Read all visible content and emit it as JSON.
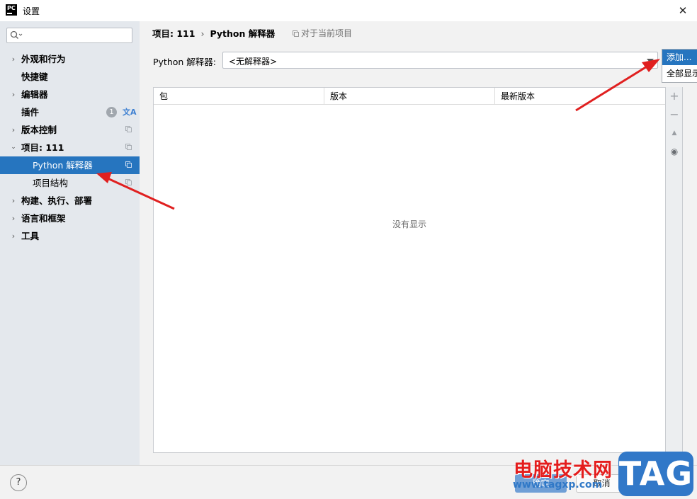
{
  "window": {
    "title": "设置",
    "logo_text": "PC",
    "close_glyph": "✕"
  },
  "sidebar": {
    "search": {
      "placeholder": ""
    },
    "items": [
      {
        "label": "外观和行为",
        "expandable": true
      },
      {
        "label": "快捷键",
        "expandable": false
      },
      {
        "label": "编辑器",
        "expandable": true
      },
      {
        "label": "插件",
        "expandable": false,
        "badge": "1",
        "translate_icon": "文A"
      },
      {
        "label": "版本控制",
        "expandable": true
      },
      {
        "label": "项目: 111",
        "expandable": true,
        "expanded": true
      },
      {
        "label": "Python 解释器",
        "child": true,
        "selected": true
      },
      {
        "label": "项目结构",
        "child": true
      },
      {
        "label": "构建、执行、部署",
        "expandable": true
      },
      {
        "label": "语言和框架",
        "expandable": true
      },
      {
        "label": "工具",
        "expandable": true
      }
    ]
  },
  "header": {
    "breadcrumb": {
      "parent": "项目: 111",
      "separator": "›",
      "current": "Python 解释器"
    },
    "scope_note": "对于当前项目"
  },
  "interpreter": {
    "label": "Python 解释器:",
    "value": "<无解释器>"
  },
  "popup_menu": {
    "add": "添加...",
    "show_all": "全部显示"
  },
  "table": {
    "columns": [
      "包",
      "版本",
      "最新版本"
    ],
    "empty_text": "没有显示"
  },
  "toolbar": {
    "add_glyph": "+",
    "remove_glyph": "−",
    "up_glyph": "▲",
    "eye_glyph": "◉"
  },
  "footer": {
    "help": "?",
    "ok": "确定",
    "cancel": "取消"
  },
  "watermark": {
    "site_name": "电脑技术网",
    "url": "www.tagxp.com",
    "tag": "TAG"
  },
  "colors": {
    "accent": "#2675bf",
    "sidebar_bg": "#e4e8ed",
    "arrow": "#e02020"
  }
}
